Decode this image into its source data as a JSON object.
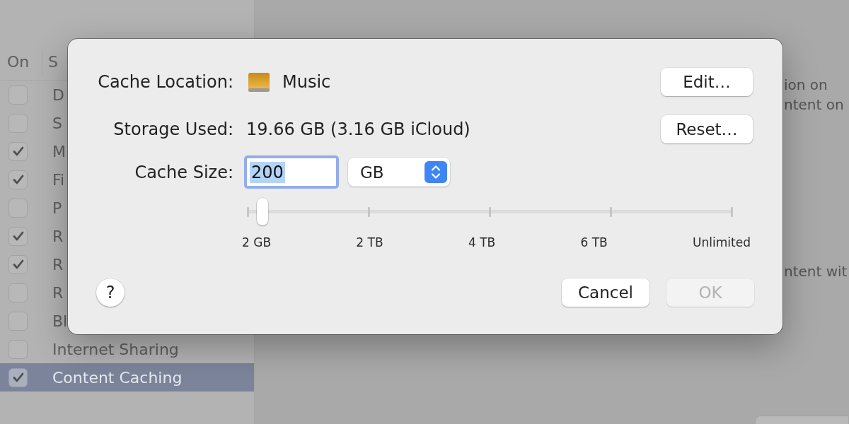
{
  "settings_window": {
    "service_list": {
      "columns": [
        "On",
        "S"
      ],
      "rows": [
        {
          "label": "D",
          "checked": false,
          "selected": false
        },
        {
          "label": "S",
          "checked": false,
          "selected": false
        },
        {
          "label": "M",
          "checked": true,
          "selected": false
        },
        {
          "label": "Fi",
          "checked": true,
          "selected": false
        },
        {
          "label": "P",
          "checked": false,
          "selected": false
        },
        {
          "label": "R",
          "checked": true,
          "selected": false
        },
        {
          "label": "R",
          "checked": true,
          "selected": false
        },
        {
          "label": "R",
          "checked": false,
          "selected": false
        },
        {
          "label": "Bl",
          "checked": false,
          "selected": false
        },
        {
          "label": "Internet Sharing",
          "checked": false,
          "selected": false
        },
        {
          "label": "Content Caching",
          "checked": true,
          "selected": true
        }
      ]
    },
    "detail": {
      "paragraphs": [
        [
          "ion on",
          "ntent on"
        ],
        [
          "ntent wit"
        ]
      ]
    }
  },
  "dialog": {
    "fields": [
      {
        "kind": "location",
        "label": "Cache Location:",
        "value": "Music",
        "button": "Edit…"
      },
      {
        "kind": "text",
        "label": "Storage Used:",
        "value": "19.66 GB (3.16 GB iCloud)",
        "button": "Reset…"
      },
      {
        "kind": "size",
        "label": "Cache Size:",
        "input": {
          "value": "200",
          "focused": true,
          "text_selected": true
        },
        "unit": "GB"
      }
    ],
    "slider": {
      "level": 0.03,
      "ticks": [
        "2 GB",
        "2 TB",
        "4 TB",
        "6 TB",
        "Unlimited"
      ]
    },
    "help": "?",
    "buttons": [
      {
        "label": "Cancel",
        "disabled": false
      },
      {
        "label": "OK",
        "disabled": true
      }
    ]
  }
}
